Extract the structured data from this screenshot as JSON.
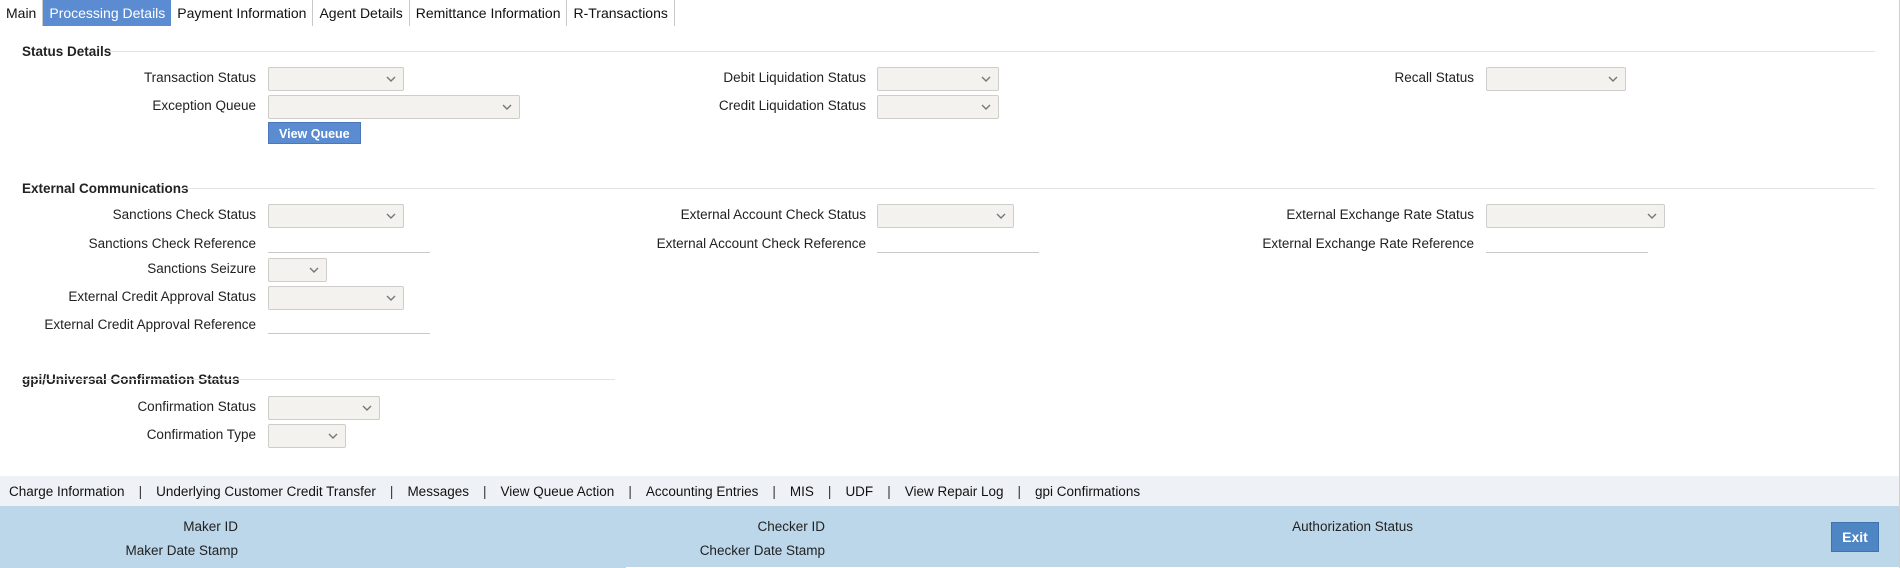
{
  "tabs": [
    {
      "label": "Main",
      "active": false
    },
    {
      "label": "Processing Details",
      "active": true
    },
    {
      "label": "Payment Information",
      "active": false
    },
    {
      "label": "Agent Details",
      "active": false
    },
    {
      "label": "Remittance Information",
      "active": false
    },
    {
      "label": "R-Transactions",
      "active": false
    }
  ],
  "status_details": {
    "title": "Status Details",
    "transaction_status": {
      "label": "Transaction Status",
      "value": ""
    },
    "exception_queue": {
      "label": "Exception Queue",
      "value": ""
    },
    "view_queue_button": "View Queue",
    "debit_liquidation_status": {
      "label": "Debit Liquidation Status",
      "value": ""
    },
    "credit_liquidation_status": {
      "label": "Credit Liquidation Status",
      "value": ""
    },
    "recall_status": {
      "label": "Recall Status",
      "value": ""
    }
  },
  "external_communications": {
    "title": "External Communications",
    "sanctions_check_status": {
      "label": "Sanctions Check Status",
      "value": ""
    },
    "sanctions_check_reference": {
      "label": "Sanctions Check Reference",
      "value": ""
    },
    "sanctions_seizure": {
      "label": "Sanctions Seizure",
      "value": ""
    },
    "external_credit_approval_status": {
      "label": "External Credit Approval Status",
      "value": ""
    },
    "external_credit_approval_reference": {
      "label": "External Credit Approval Reference",
      "value": ""
    },
    "external_account_check_status": {
      "label": "External Account Check Status",
      "value": ""
    },
    "external_account_check_reference": {
      "label": "External Account Check Reference",
      "value": ""
    },
    "external_exchange_rate_status": {
      "label": "External Exchange Rate Status",
      "value": ""
    },
    "external_exchange_rate_reference": {
      "label": "External Exchange Rate Reference",
      "value": ""
    }
  },
  "gpi": {
    "title": "gpi/Universal Confirmation Status",
    "confirmation_status": {
      "label": "Confirmation Status",
      "value": ""
    },
    "confirmation_type": {
      "label": "Confirmation Type",
      "value": ""
    }
  },
  "footer_links": [
    "Charge Information",
    "Underlying Customer Credit Transfer",
    "Messages",
    "View Queue Action",
    "Accounting Entries",
    "MIS",
    "UDF",
    "View Repair Log",
    "gpi Confirmations"
  ],
  "footer_separator": "|",
  "audit": {
    "maker_id": "Maker ID",
    "maker_date_stamp": "Maker Date Stamp",
    "checker_id": "Checker ID",
    "checker_date_stamp": "Checker Date Stamp",
    "authorization_status": "Authorization Status",
    "exit_button": "Exit"
  },
  "icons": {
    "dropdown": "chevron-down-icon"
  },
  "colors": {
    "accent_blue": "#5b8bd0",
    "audit_bar": "#bcd6ea",
    "link_bar": "#eef2f7",
    "select_bg": "#f4f2ef"
  }
}
